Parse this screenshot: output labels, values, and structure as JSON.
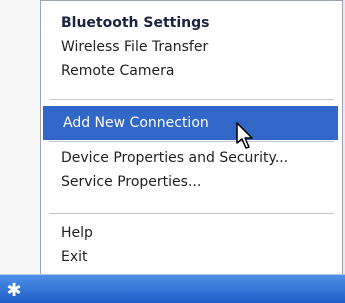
{
  "menu": {
    "items": [
      {
        "label": "Bluetooth Settings"
      },
      {
        "label": "Wireless File Transfer"
      },
      {
        "label": "Remote Camera"
      },
      {
        "label": "Add New Connection"
      },
      {
        "label": "Device Properties and Security..."
      },
      {
        "label": "Service Properties..."
      },
      {
        "label": "Help"
      },
      {
        "label": "Exit"
      }
    ]
  },
  "colors": {
    "highlight": "#3167c6",
    "taskbar": "#2f6fd7"
  },
  "icons": {
    "cursor": "mouse-pointer-icon",
    "tray": "bluetooth-icon"
  }
}
